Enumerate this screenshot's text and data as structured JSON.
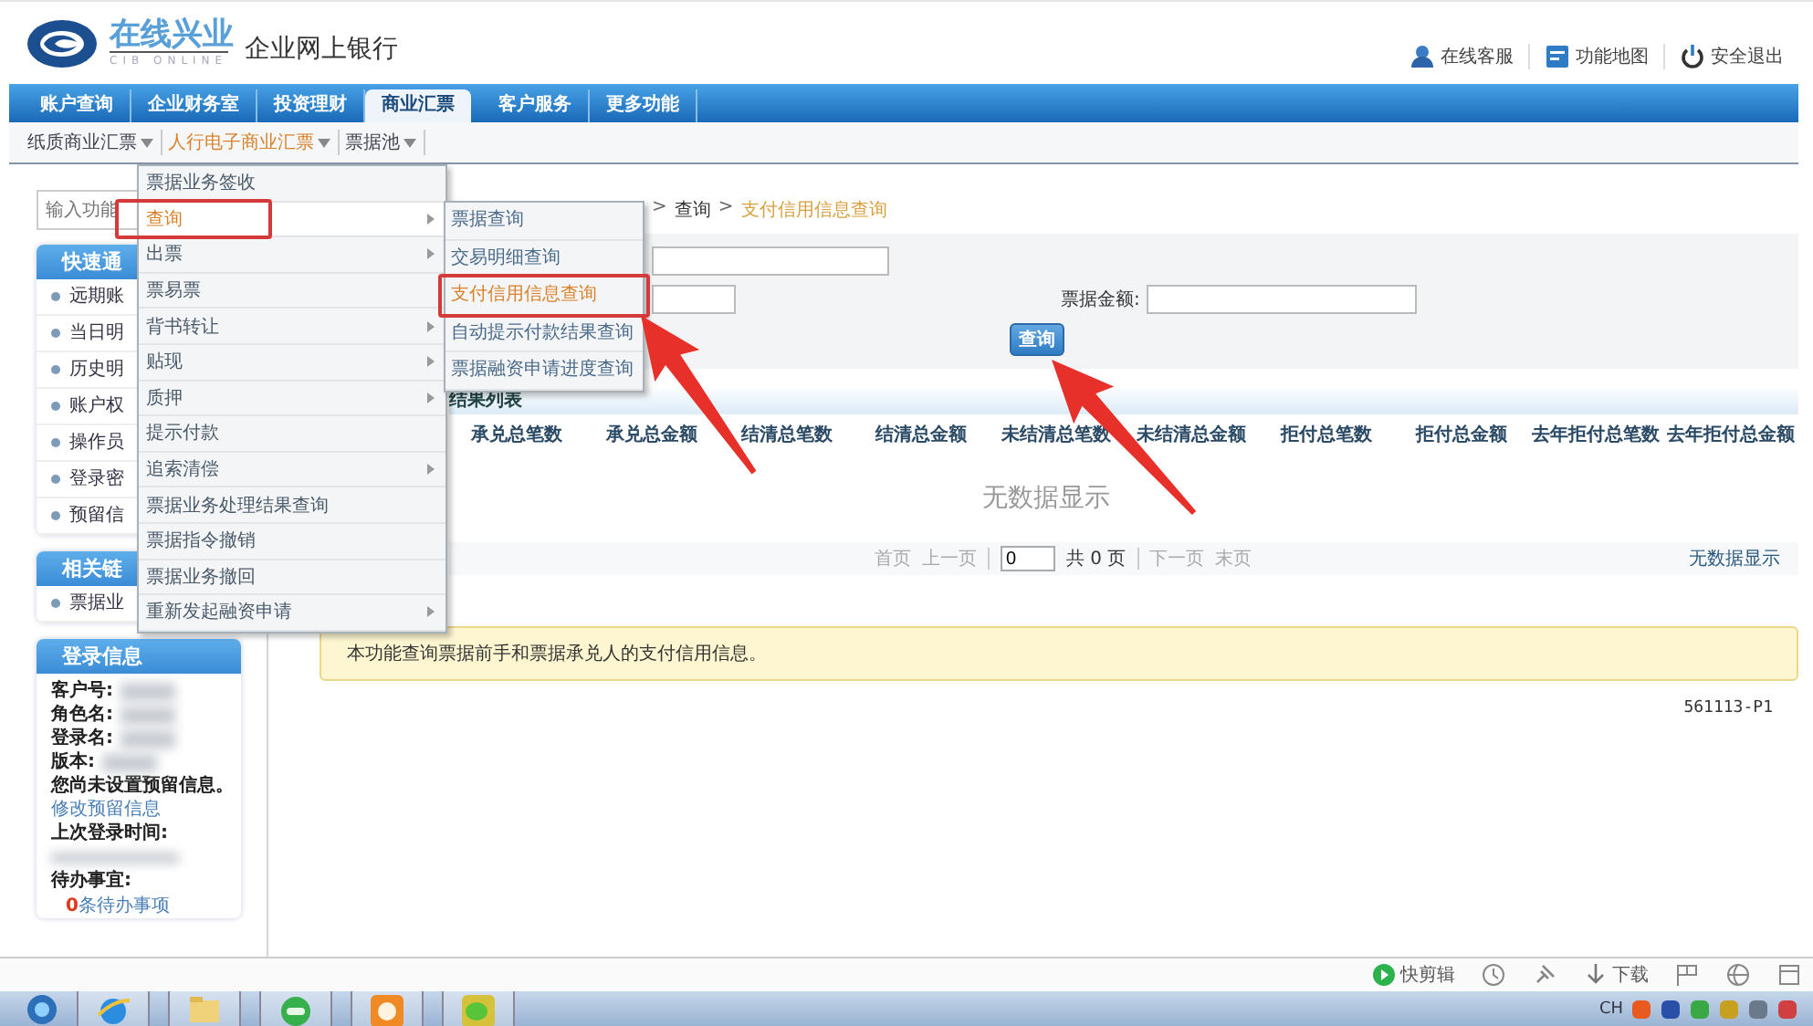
{
  "header": {
    "logo_title": "在线兴业",
    "logo_subtitle": "CIB ONLINE",
    "product": "企业网上银行",
    "links": [
      {
        "label": "在线客服"
      },
      {
        "label": "功能地图"
      },
      {
        "label": "安全退出"
      }
    ]
  },
  "nav": {
    "tabs": [
      {
        "label": "账户查询",
        "selected": false
      },
      {
        "label": "企业财务室",
        "selected": false
      },
      {
        "label": "投资理财",
        "selected": false
      },
      {
        "label": "商业汇票",
        "selected": true
      },
      {
        "label": "客户服务",
        "selected": false
      },
      {
        "label": "更多功能",
        "selected": false
      }
    ]
  },
  "subnav": [
    {
      "label": "纸质商业汇票",
      "selected": false
    },
    {
      "label": "人行电子商业汇票",
      "selected": true
    },
    {
      "label": "票据池",
      "selected": false
    }
  ],
  "sidebar": {
    "search": {
      "placeholder": "输入功能"
    },
    "panels": [
      {
        "title": "快速通",
        "items": [
          "远期账",
          "当日明",
          "历史明",
          "账户权",
          "操作员",
          "登录密",
          "预留信"
        ]
      },
      {
        "title": "相关链",
        "items": [
          "票据业"
        ]
      }
    ],
    "login": {
      "title": "登录信息",
      "fields": [
        "客户号:",
        "角色名:",
        "登录名:",
        "版本:"
      ],
      "notice": "您尚未设置预留信息。",
      "link": "修改预留信息",
      "last_login_label": "上次登录时间:",
      "todo_label": "待办事宜:",
      "todo_count": "0",
      "todo_text": "条待办事项"
    }
  },
  "breadcrumb": {
    "separator": ">",
    "items": [
      "查询",
      "支付信用信息查询"
    ]
  },
  "form": {
    "amount_label": "票据金额:",
    "button": {
      "label": "查询",
      "pointer": true
    }
  },
  "results": {
    "title": "结果列表",
    "columns": [
      "承兑总笔数",
      "承兑总金额",
      "结清总笔数",
      "结清总金额",
      "未结清总笔数",
      "未结清总金额",
      "拒付总笔数",
      "拒付总金额",
      "去年拒付总笔数",
      "去年拒付总金额"
    ],
    "empty": "无数据显示"
  },
  "pager": {
    "first": "首页",
    "prev": "上一页",
    "page": "0",
    "total": "共 0 页",
    "next": "下一页",
    "last": "末页",
    "status": "无数据显示"
  },
  "note": "本功能查询票据前手和票据承兑人的支付信用信息。",
  "page_code": "561113-P1",
  "menu": {
    "items": [
      {
        "label": "票据业务签收",
        "submenu": false,
        "selected": false,
        "framed": false
      },
      {
        "label": "查询",
        "submenu": true,
        "selected": true,
        "framed": true
      },
      {
        "label": "出票",
        "submenu": true,
        "selected": false,
        "framed": false
      },
      {
        "label": "票易票",
        "submenu": false,
        "selected": false,
        "framed": false
      },
      {
        "label": "背书转让",
        "submenu": true,
        "selected": false,
        "framed": false
      },
      {
        "label": "贴现",
        "submenu": true,
        "selected": false,
        "framed": false
      },
      {
        "label": "质押",
        "submenu": true,
        "selected": false,
        "framed": false
      },
      {
        "label": "提示付款",
        "submenu": false,
        "selected": false,
        "framed": false
      },
      {
        "label": "追索清偿",
        "submenu": true,
        "selected": false,
        "framed": false
      },
      {
        "label": "票据业务处理结果查询",
        "submenu": false,
        "selected": false,
        "framed": false
      },
      {
        "label": "票据指令撤销",
        "submenu": false,
        "selected": false,
        "framed": false
      },
      {
        "label": "票据业务撤回",
        "submenu": false,
        "selected": false,
        "framed": false
      },
      {
        "label": "重新发起融资申请",
        "submenu": true,
        "selected": false,
        "framed": false
      }
    ]
  },
  "submenu": {
    "items": [
      {
        "label": "票据查询",
        "selected": false,
        "framed": false
      },
      {
        "label": "交易明细查询",
        "selected": false,
        "framed": false
      },
      {
        "label": "支付信用信息查询",
        "selected": true,
        "framed": true
      },
      {
        "label": "自动提示付款结果查询",
        "selected": false,
        "framed": false
      },
      {
        "label": "票据融资申请进度查询",
        "selected": false,
        "framed": false
      }
    ]
  },
  "status_bar": {
    "items": [
      {
        "label": "快剪辑"
      },
      {
        "label": "下载"
      }
    ]
  },
  "taskbar": {
    "tray_lang": "CH"
  }
}
